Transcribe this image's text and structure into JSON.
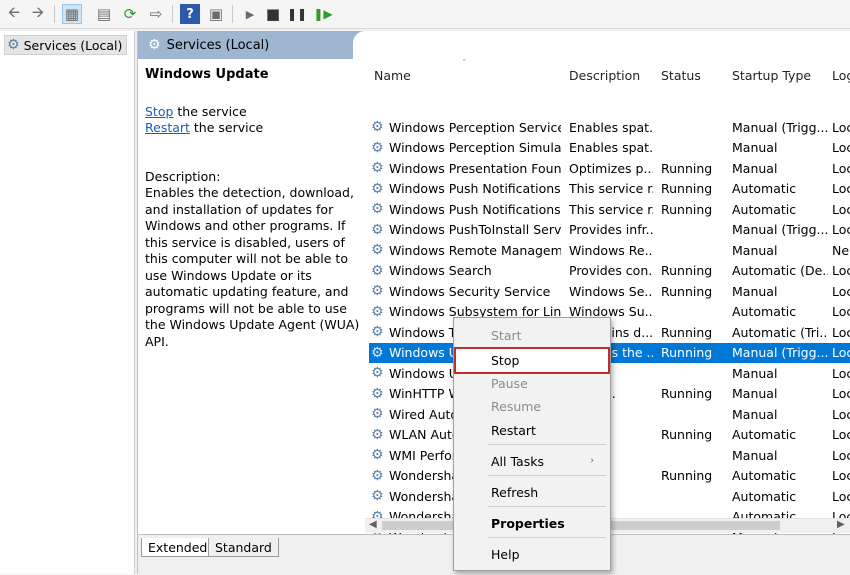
{
  "toolbar": {
    "icons": [
      "back-arrow-icon",
      "forward-arrow-icon",
      "console-tree-icon",
      "properties-icon",
      "refresh-icon",
      "export-list-icon",
      "help-icon",
      "action-pane-icon",
      "start-service-icon",
      "stop-service-icon",
      "pause-service-icon",
      "restart-service-icon"
    ]
  },
  "tree": {
    "root_label": "Services (Local)"
  },
  "pane": {
    "header_title": "Services (Local)"
  },
  "description_panel": {
    "service_name": "Windows Update",
    "stop_link": "Stop",
    "stop_suffix": " the service",
    "restart_link": "Restart",
    "restart_suffix": " the service",
    "description_label": "Description:",
    "description_text": "Enables the detection, download, and installation of updates for Windows and other programs. If this service is disabled, users of this computer will not be able to use Windows Update or its automatic updating feature, and programs will not be able to use the Windows Update Agent (WUA) API."
  },
  "columns": [
    "Name",
    "Description",
    "Status",
    "Startup Type",
    "Log"
  ],
  "rows": [
    {
      "name": "Windows Perception Service",
      "description": "Enables spat...",
      "status": "",
      "startup": "Manual (Trigg...",
      "log": "Loc"
    },
    {
      "name": "Windows Perception Simulat...",
      "description": "Enables spat...",
      "status": "",
      "startup": "Manual",
      "log": "Loc"
    },
    {
      "name": "Windows Presentation Foun...",
      "description": "Optimizes p...",
      "status": "Running",
      "startup": "Manual",
      "log": "Loc"
    },
    {
      "name": "Windows Push Notifications...",
      "description": "This service r...",
      "status": "Running",
      "startup": "Automatic",
      "log": "Loc"
    },
    {
      "name": "Windows Push Notifications...",
      "description": "This service r...",
      "status": "Running",
      "startup": "Automatic",
      "log": "Loc"
    },
    {
      "name": "Windows PushToInstall Servi...",
      "description": "Provides infr...",
      "status": "",
      "startup": "Manual (Trigg...",
      "log": "Loc"
    },
    {
      "name": "Windows Remote Managem...",
      "description": "Windows Re...",
      "status": "",
      "startup": "Manual",
      "log": "Ne"
    },
    {
      "name": "Windows Search",
      "description": "Provides con...",
      "status": "Running",
      "startup": "Automatic (De...",
      "log": "Loc"
    },
    {
      "name": "Windows Security Service",
      "description": "Windows Se...",
      "status": "Running",
      "startup": "Manual",
      "log": "Loc"
    },
    {
      "name": "Windows Subsystem for Linux",
      "description": "Windows Su...",
      "status": "",
      "startup": "Automatic",
      "log": "Loc"
    },
    {
      "name": "Windows Time",
      "description": "Maintains d...",
      "status": "Running",
      "startup": "Automatic (Tri...",
      "log": "Loc"
    },
    {
      "name": "Windows Update",
      "description": "Enables the ...",
      "status": "Running",
      "startup": "Manual (Trigg...",
      "log": "Loc",
      "selected": true
    },
    {
      "name": "Windows U",
      "description": "rem...",
      "status": "",
      "startup": "Manual",
      "log": "Loc"
    },
    {
      "name": "WinHTTP W",
      "description": "TP im...",
      "status": "Running",
      "startup": "Manual",
      "log": "Loc"
    },
    {
      "name": "Wired Auto",
      "description": "ed A...",
      "status": "",
      "startup": "Manual",
      "log": "Loc"
    },
    {
      "name": "WLAN Auto",
      "description": "ANS...",
      "status": "Running",
      "startup": "Automatic",
      "log": "Loc"
    },
    {
      "name": "WMI Perfor",
      "description": "es p...",
      "status": "",
      "startup": "Manual",
      "log": "Loc"
    },
    {
      "name": "Wondersha",
      "description": "rshar...",
      "status": "Running",
      "startup": "Automatic",
      "log": "Loc"
    },
    {
      "name": "Wondersha",
      "description": "",
      "status": "",
      "startup": "Automatic",
      "log": "Loc"
    },
    {
      "name": "Wondersha",
      "description": "rshar...",
      "status": "",
      "startup": "Automatic",
      "log": "Loc"
    },
    {
      "name": "Wondersha",
      "description": "rshar...",
      "status": "",
      "startup": "Manual",
      "log": "Loc"
    }
  ],
  "tabs": {
    "extended": "Extended",
    "standard": "Standard"
  },
  "context_menu": {
    "start": "Start",
    "stop": "Stop",
    "pause": "Pause",
    "resume": "Resume",
    "restart": "Restart",
    "all_tasks": "All Tasks",
    "refresh": "Refresh",
    "properties": "Properties",
    "help": "Help"
  },
  "colors": {
    "selection": "#0078d7",
    "header_bar": "#9fb6d1",
    "highlight_border": "#c42b2b",
    "link": "#1a5fb4"
  }
}
